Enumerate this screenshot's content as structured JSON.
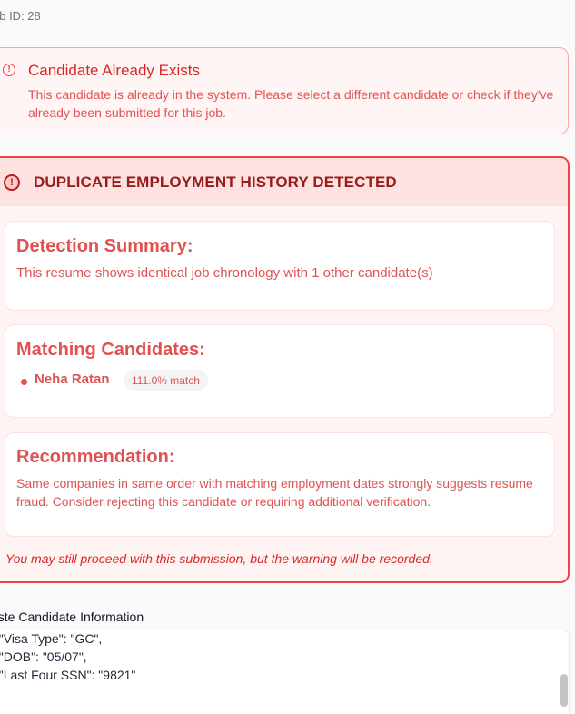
{
  "job": {
    "id_label": "ob ID: 28"
  },
  "exists_alert": {
    "icon": "alert-circle-icon",
    "title": "Candidate Already Exists",
    "message": "This candidate is already in the system. Please select a different candidate or check if they've already been submitted for this job."
  },
  "duplicate": {
    "icon": "alert-circle-icon",
    "title": "DUPLICATE EMPLOYMENT HISTORY DETECTED",
    "summary": {
      "title": "Detection Summary:",
      "text": "This resume shows identical job chronology with 1 other candidate(s)"
    },
    "matching": {
      "title": "Matching Candidates:",
      "candidates": [
        {
          "name": "Neha Ratan",
          "match": "111.0% match"
        }
      ]
    },
    "recommendation": {
      "title": "Recommendation:",
      "text": "Same companies in same order with matching employment dates strongly suggests resume fraud. Consider rejecting this candidate or requiring additional verification."
    },
    "note": "You may still proceed with this submission, but the warning will be recorded."
  },
  "paste": {
    "label": "aste Candidate Information",
    "lines": [
      "  \"Visa Type\": \"GC\",",
      "  \"DOB\": \"05/07\",",
      "  \"Last Four SSN\": \"9821\"",
      "}"
    ]
  },
  "colors": {
    "accent_red": "#ef4444",
    "dark_red": "#991b1b",
    "alert_bg": "#fee2e2"
  }
}
